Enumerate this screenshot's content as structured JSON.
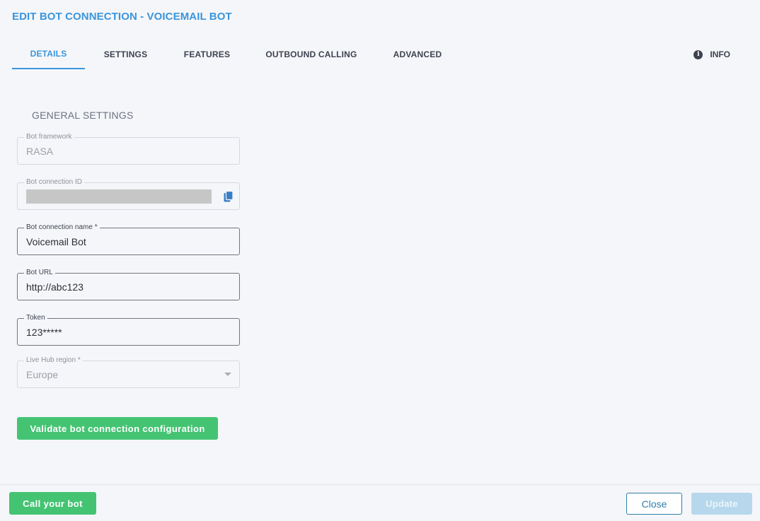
{
  "dialog": {
    "title": "EDIT BOT CONNECTION - VOICEMAIL BOT"
  },
  "tabs": [
    {
      "label": "DETAILS",
      "active": true
    },
    {
      "label": "SETTINGS",
      "active": false
    },
    {
      "label": "FEATURES",
      "active": false
    },
    {
      "label": "OUTBOUND CALLING",
      "active": false
    },
    {
      "label": "ADVANCED",
      "active": false
    }
  ],
  "info_tab": {
    "label": "INFO",
    "icon": "info-icon"
  },
  "section": {
    "title": "GENERAL SETTINGS"
  },
  "fields": {
    "bot_framework": {
      "label": "Bot framework",
      "value": "RASA",
      "disabled": true
    },
    "bot_connection_id": {
      "label": "Bot connection ID",
      "value": "",
      "redacted": true,
      "icon": "copy-icon"
    },
    "bot_connection_name": {
      "label": "Bot connection name *",
      "value": "Voicemail Bot"
    },
    "bot_url": {
      "label": "Bot URL",
      "value": "http://abc123"
    },
    "token": {
      "label": "Token",
      "value": "123*****"
    },
    "live_hub_region": {
      "label": "Live Hub region *",
      "value": "Europe",
      "disabled": true,
      "icon": "chevron-down-icon"
    }
  },
  "buttons": {
    "validate": "Validate bot connection configuration",
    "call_bot": "Call your bot",
    "close": "Close",
    "update": "Update"
  },
  "colors": {
    "accent": "#3a95dc",
    "green": "#44c472",
    "close_border": "#2f7fa8",
    "update_disabled": "#b7d8ec"
  }
}
